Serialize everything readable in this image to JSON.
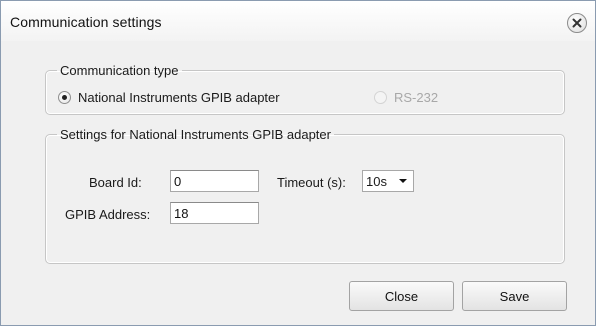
{
  "window": {
    "title": "Communication settings"
  },
  "communication_type": {
    "legend": "Communication type",
    "options": [
      {
        "label": "National Instruments GPIB adapter",
        "checked": true,
        "enabled": true
      },
      {
        "label": "RS-232",
        "checked": false,
        "enabled": false
      }
    ]
  },
  "gpib_settings": {
    "legend": "Settings for National Instruments GPIB adapter",
    "board_id_label": "Board Id:",
    "board_id_value": "0",
    "timeout_label": "Timeout (s):",
    "timeout_value": "10s",
    "gpib_address_label": "GPIB Address:",
    "gpib_address_value": "18"
  },
  "buttons": {
    "close_label": "Close",
    "save_label": "Save"
  },
  "icons": {
    "close": "close-icon",
    "dropdown": "chevron-down-icon"
  }
}
